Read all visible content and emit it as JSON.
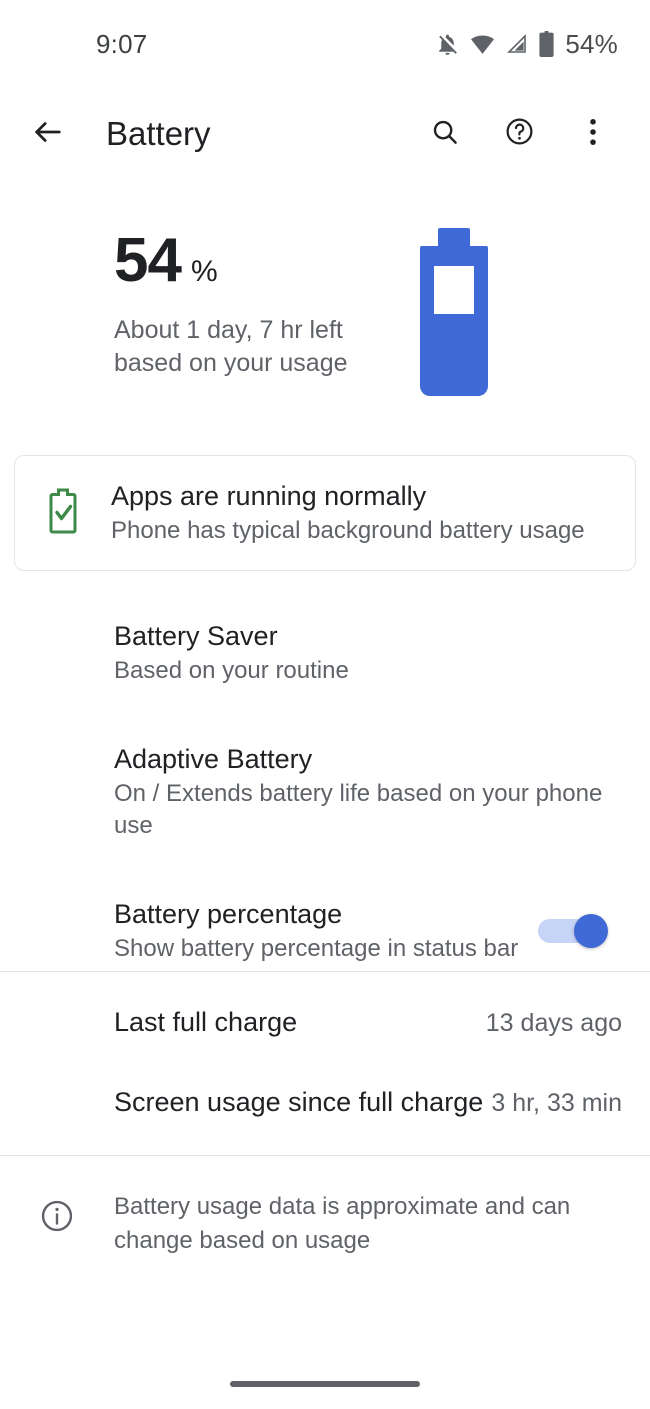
{
  "status_bar": {
    "time": "9:07",
    "battery_percent": "54%",
    "icons": [
      "notifications-off-icon",
      "wifi-icon",
      "cell-signal-icon",
      "battery-icon"
    ]
  },
  "app_bar": {
    "back_label": "back-arrow",
    "title": "Battery",
    "actions": [
      "search-icon",
      "help-icon",
      "more-options-icon"
    ]
  },
  "summary": {
    "percent_value": "54",
    "percent_sign": "%",
    "estimate_line_1": "About 1 day, 7 hr left",
    "estimate_line_2": "based on your usage",
    "battery_fill_percent": 54,
    "battery_color": "#3f69d6"
  },
  "status_card": {
    "icon": "battery-check-icon",
    "icon_color": "#3e8a48",
    "title": "Apps are running normally",
    "subtitle": "Phone has typical background battery usage"
  },
  "preferences": [
    {
      "title": "Battery Saver",
      "subtitle": "Based on your routine",
      "has_switch": false
    },
    {
      "title": "Adaptive Battery",
      "subtitle": "On / Extends battery life based on your phone use",
      "has_switch": false
    },
    {
      "title": "Battery percentage",
      "subtitle": "Show battery percentage in status bar",
      "has_switch": true,
      "switch_state": "on",
      "switch_color": "#3f69d6"
    }
  ],
  "stats": [
    {
      "label": "Last full charge",
      "value": "13 days ago"
    },
    {
      "label": "Screen usage since full charge",
      "value": "3 hr, 33 min"
    }
  ],
  "footer": {
    "icon": "info-icon",
    "line_1": "Battery usage data is approximate and can",
    "line_2": "change based on usage"
  }
}
